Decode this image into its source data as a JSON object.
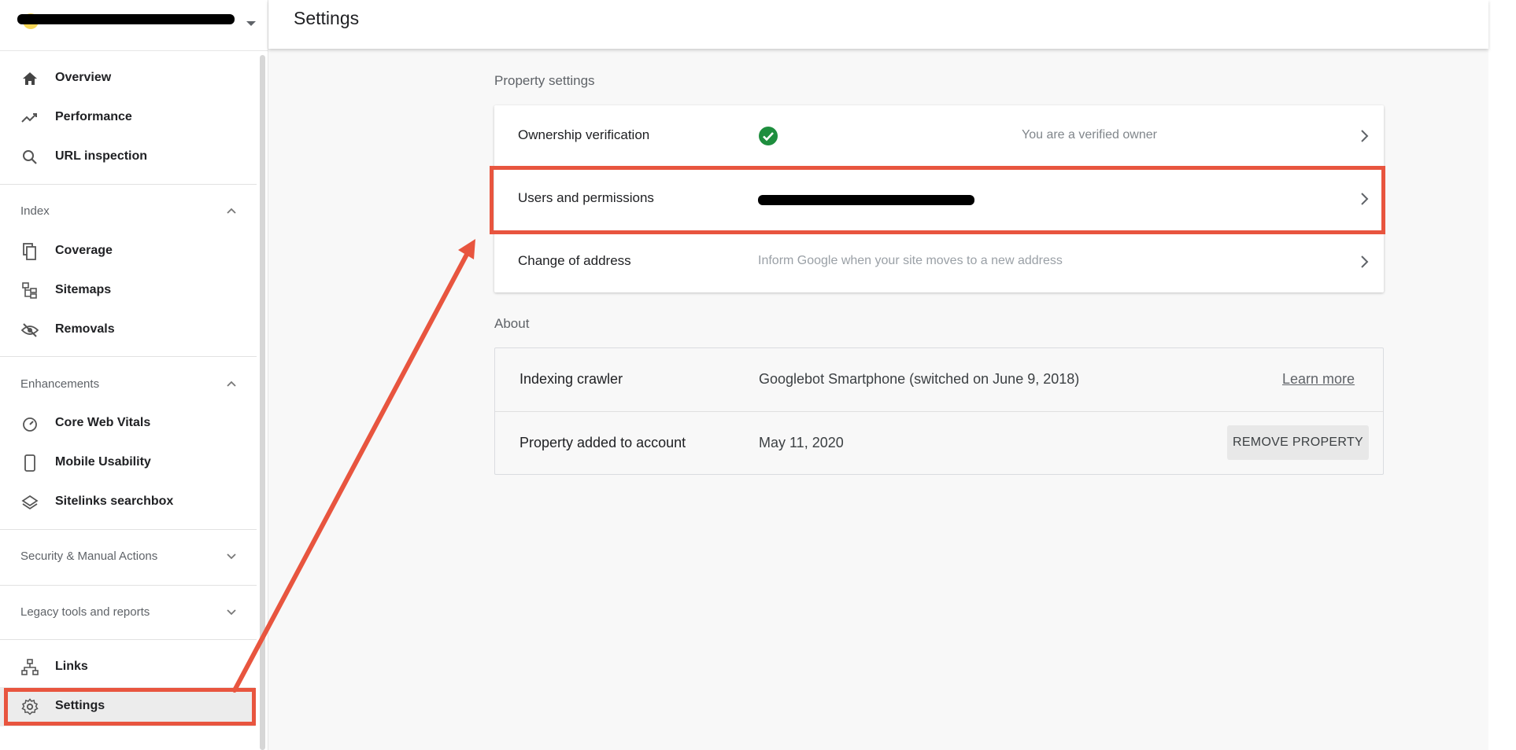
{
  "header": {
    "title": "Settings"
  },
  "sidebar": {
    "property_selector": {
      "name_redacted": true
    },
    "nav_top": [
      {
        "label": "Overview",
        "icon": "home-icon"
      },
      {
        "label": "Performance",
        "icon": "trending-up-icon"
      },
      {
        "label": "URL inspection",
        "icon": "search-icon"
      }
    ],
    "sections": {
      "index": {
        "label": "Index",
        "expanded": true,
        "items": [
          {
            "label": "Coverage",
            "icon": "copy-icon"
          },
          {
            "label": "Sitemaps",
            "icon": "sitemap-icon"
          },
          {
            "label": "Removals",
            "icon": "eye-off-icon"
          }
        ]
      },
      "enhancements": {
        "label": "Enhancements",
        "expanded": true,
        "items": [
          {
            "label": "Core Web Vitals",
            "icon": "speedometer-icon"
          },
          {
            "label": "Mobile Usability",
            "icon": "smartphone-icon"
          },
          {
            "label": "Sitelinks searchbox",
            "icon": "layers-icon"
          }
        ]
      },
      "security": {
        "label": "Security & Manual Actions",
        "expanded": false
      },
      "legacy": {
        "label": "Legacy tools and reports",
        "expanded": false
      }
    },
    "nav_bottom": [
      {
        "label": "Links",
        "icon": "links-icon"
      },
      {
        "label": "Settings",
        "icon": "gear-icon",
        "selected": true
      }
    ]
  },
  "main": {
    "property_settings": {
      "title": "Property settings",
      "rows": [
        {
          "label": "Ownership verification",
          "value": "You are a verified owner",
          "status_icon": "check-circle-icon"
        },
        {
          "label": "Users and permissions",
          "value_redacted": true
        },
        {
          "label": "Change of address",
          "value": "Inform Google when your site moves to a new address"
        }
      ]
    },
    "about": {
      "title": "About",
      "rows": [
        {
          "label": "Indexing crawler",
          "value": "Googlebot Smartphone (switched on June 9, 2018)",
          "action": "Learn more"
        },
        {
          "label": "Property added to account",
          "value": "May 11, 2020",
          "action": "REMOVE PROPERTY"
        }
      ]
    }
  },
  "colors": {
    "annotation": "#e8553f",
    "verified_green": "#1e8e3e",
    "background_main": "#f8f8f8",
    "selected_nav": "#ececec"
  }
}
